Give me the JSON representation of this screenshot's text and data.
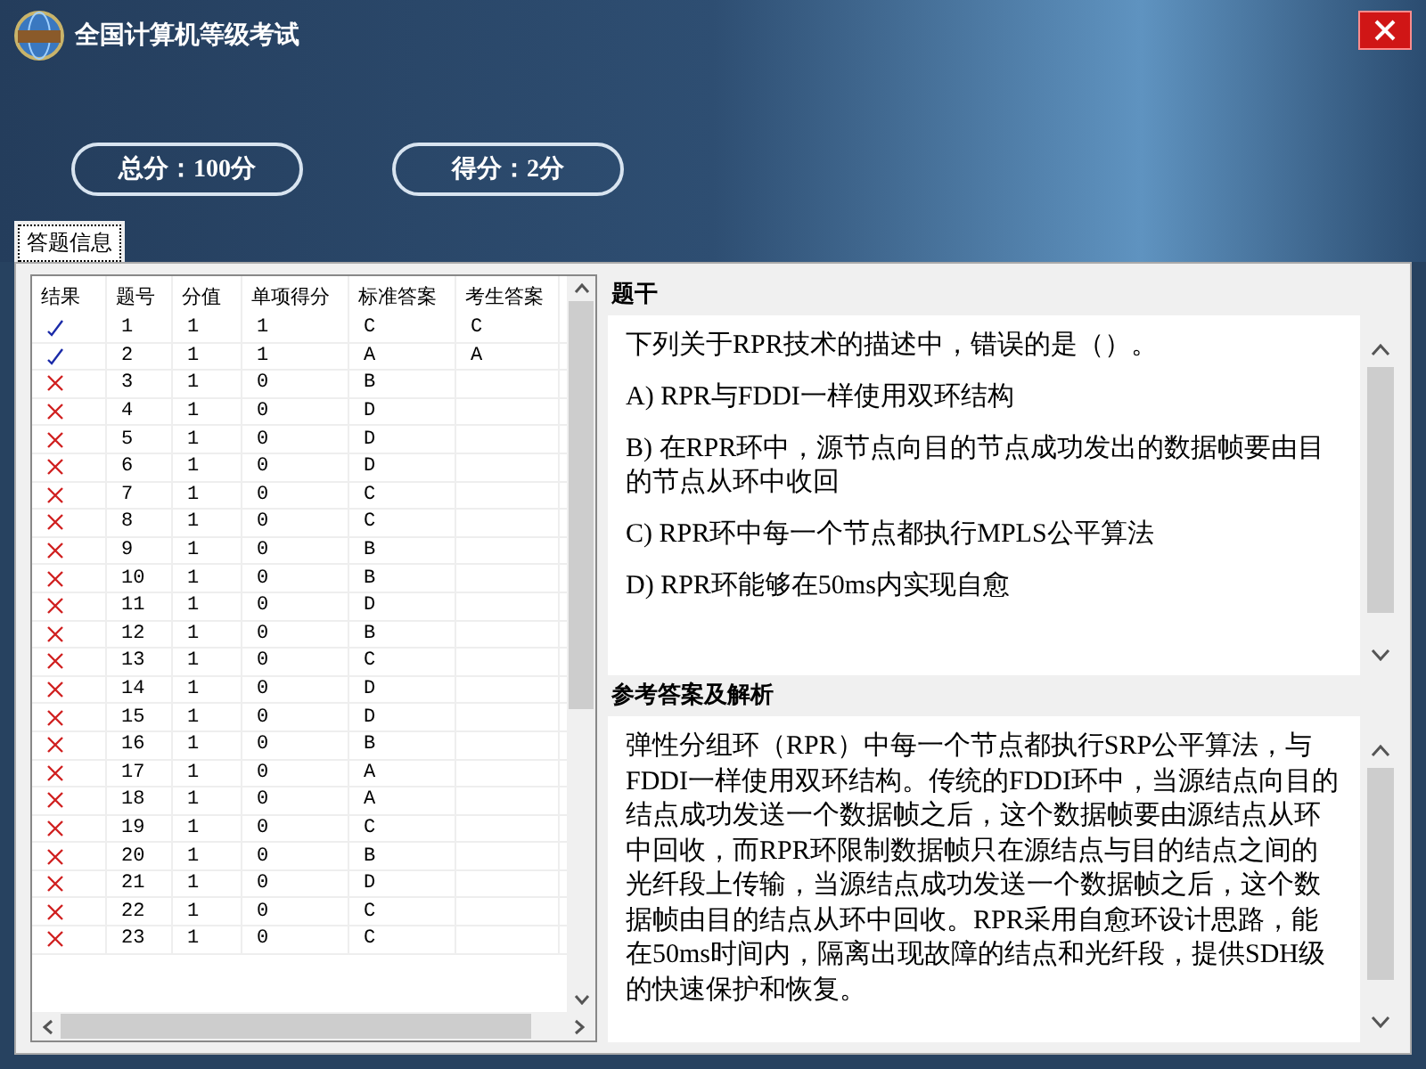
{
  "window": {
    "title": "全国计算机等级考试"
  },
  "scores": [
    {
      "text": "总分：100分"
    },
    {
      "text": "得分：2分"
    }
  ],
  "tabs": [
    {
      "label": "答题信息",
      "selected": true
    }
  ],
  "table": {
    "columns": [
      "结果",
      "题号",
      "分值",
      "单项得分",
      "标准答案",
      "考生答案"
    ],
    "rows": [
      {
        "correct": true,
        "cells": [
          "",
          "1",
          "1",
          "1",
          "C",
          "C"
        ]
      },
      {
        "correct": true,
        "cells": [
          "",
          "2",
          "1",
          "1",
          "A",
          "A"
        ]
      },
      {
        "correct": false,
        "cells": [
          "",
          "3",
          "1",
          "0",
          "B",
          ""
        ]
      },
      {
        "correct": false,
        "cells": [
          "",
          "4",
          "1",
          "0",
          "D",
          ""
        ]
      },
      {
        "correct": false,
        "cells": [
          "",
          "5",
          "1",
          "0",
          "D",
          ""
        ]
      },
      {
        "correct": false,
        "cells": [
          "",
          "6",
          "1",
          "0",
          "D",
          ""
        ]
      },
      {
        "correct": false,
        "cells": [
          "",
          "7",
          "1",
          "0",
          "C",
          ""
        ]
      },
      {
        "correct": false,
        "cells": [
          "",
          "8",
          "1",
          "0",
          "C",
          ""
        ]
      },
      {
        "correct": false,
        "cells": [
          "",
          "9",
          "1",
          "0",
          "B",
          ""
        ]
      },
      {
        "correct": false,
        "cells": [
          "",
          "10",
          "1",
          "0",
          "B",
          ""
        ]
      },
      {
        "correct": false,
        "cells": [
          "",
          "11",
          "1",
          "0",
          "D",
          ""
        ]
      },
      {
        "correct": false,
        "cells": [
          "",
          "12",
          "1",
          "0",
          "B",
          ""
        ]
      },
      {
        "correct": false,
        "cells": [
          "",
          "13",
          "1",
          "0",
          "C",
          ""
        ]
      },
      {
        "correct": false,
        "cells": [
          "",
          "14",
          "1",
          "0",
          "D",
          ""
        ]
      },
      {
        "correct": false,
        "cells": [
          "",
          "15",
          "1",
          "0",
          "D",
          ""
        ]
      },
      {
        "correct": false,
        "cells": [
          "",
          "16",
          "1",
          "0",
          "B",
          ""
        ]
      },
      {
        "correct": false,
        "cells": [
          "",
          "17",
          "1",
          "0",
          "A",
          ""
        ]
      },
      {
        "correct": false,
        "cells": [
          "",
          "18",
          "1",
          "0",
          "A",
          ""
        ]
      },
      {
        "correct": false,
        "cells": [
          "",
          "19",
          "1",
          "0",
          "C",
          ""
        ]
      },
      {
        "correct": false,
        "cells": [
          "",
          "20",
          "1",
          "0",
          "B",
          ""
        ]
      },
      {
        "correct": false,
        "cells": [
          "",
          "21",
          "1",
          "0",
          "D",
          ""
        ]
      },
      {
        "correct": false,
        "cells": [
          "",
          "22",
          "1",
          "0",
          "C",
          ""
        ]
      },
      {
        "correct": false,
        "cells": [
          "",
          "23",
          "1",
          "0",
          "C",
          ""
        ]
      }
    ]
  },
  "question": {
    "heading": "题干",
    "paragraphs": [
      "下列关于RPR技术的描述中，错误的是（）。",
      "A) RPR与FDDI一样使用双环结构",
      "B) 在RPR环中，源节点向目的节点成功发出的数据帧要由目的节点从环中收回",
      "C) RPR环中每一个节点都执行MPLS公平算法",
      "D) RPR环能够在50ms内实现自愈"
    ]
  },
  "analysis": {
    "heading": "参考答案及解析",
    "text": "弹性分组环（RPR）中每一个节点都执行SRP公平算法，与FDDI一样使用双环结构。传统的FDDI环中，当源结点向目的结点成功发送一个数据帧之后，这个数据帧要由源结点从环中回收，而RPR环限制数据帧只在源结点与目的结点之间的光纤段上传输，当源结点成功发送一个数据帧之后，这个数据帧由目的结点从环中回收。RPR采用自愈环设计思路，能在50ms时间内，隔离出现故障的结点和光纤段，提供SDH级的快速保护和恢复。"
  }
}
